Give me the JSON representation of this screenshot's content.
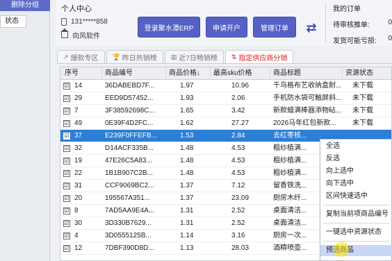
{
  "left": {
    "delete_group": "删除分组",
    "status_tab": "状态"
  },
  "user": {
    "title": "个人中心",
    "phone": "131*****858",
    "shop": "向风软件"
  },
  "buttons": {
    "login_erp": "登录聚水潭ERP",
    "apply_account": "申请开户",
    "manage_orders": "管理订单"
  },
  "orders": {
    "title": "我的订单",
    "pending_label": "待审核推单:",
    "pending_value": "0",
    "shipped_label": "发货可能亏损:",
    "shipped_value": "0"
  },
  "tabs": [
    {
      "label": "爆款专区",
      "icon": "↗"
    },
    {
      "label": "昨日热销榜",
      "icon": "🏆"
    },
    {
      "label": "近7日畅销榜",
      "icon": "▥"
    },
    {
      "label": "指定供应商分销",
      "icon": "⇅"
    }
  ],
  "table": {
    "columns": [
      "序号",
      "商品编号",
      "商品价格↓",
      "最高sku价格",
      "商品标题",
      "资源状态"
    ],
    "rows": [
      {
        "checked": "☑",
        "no": "14",
        "code": "36DABEBD7F...",
        "price": "1.97",
        "max_sku": "10.96",
        "title": "千鸟格布艺收纳盒耐...",
        "status": "未下载"
      },
      {
        "checked": "☑",
        "no": "29",
        "code": "EED9D57452...",
        "price": "1.93",
        "max_sku": "2.06",
        "title": "手机防水袋可触屏斜...",
        "status": "未下载"
      },
      {
        "checked": "☑",
        "no": "7",
        "code": "3F38592698C...",
        "price": "1.65",
        "max_sku": "3.42",
        "title": "新款蜡满棒器添物砧...",
        "status": "未下载"
      },
      {
        "checked": "☑",
        "no": "49",
        "code": "0E39F4D2FC...",
        "price": "1.62",
        "max_sku": "27.27",
        "title": "2026马年红包新款...",
        "status": "未下载"
      },
      {
        "checked": "☑",
        "no": "37",
        "code": "E239F0FFEFB...",
        "price": "1.53",
        "max_sku": "2.84",
        "title": "去红枣核...",
        "status": "",
        "selected": true
      },
      {
        "checked": "☑",
        "no": "32",
        "code": "D14ACF335B...",
        "price": "1.48",
        "max_sku": "4.53",
        "title": "粗纱植满...",
        "status": ""
      },
      {
        "checked": "☑",
        "no": "19",
        "code": "47E26C5A83...",
        "price": "1.48",
        "max_sku": "4.53",
        "title": "粗纱植满...",
        "status": ""
      },
      {
        "checked": "☑",
        "no": "22",
        "code": "1B1B907C2B...",
        "price": "1.48",
        "max_sku": "4.53",
        "title": "粗纱植满...",
        "status": ""
      },
      {
        "checked": "☑",
        "no": "31",
        "code": "CCF9069BC2...",
        "price": "1.37",
        "max_sku": "7.12",
        "title": "留香铁洗...",
        "status": ""
      },
      {
        "checked": "☑",
        "no": "20",
        "code": "195567A351...",
        "price": "1.37",
        "max_sku": "23.09",
        "title": "厨房木纤...",
        "status": ""
      },
      {
        "checked": "☑",
        "no": "8",
        "code": "7AD5AA9E4A...",
        "price": "1.31",
        "max_sku": "2.52",
        "title": "桌面清洁...",
        "status": ""
      },
      {
        "checked": "☑",
        "no": "30",
        "code": "3D330B7629...",
        "price": "1.31",
        "max_sku": "2.52",
        "title": "桌面清洁...",
        "status": ""
      },
      {
        "checked": "☑",
        "no": "4",
        "code": "3D0555125B...",
        "price": "1.14",
        "max_sku": "3.16",
        "title": "厨房一次...",
        "status": ""
      },
      {
        "checked": "☑",
        "no": "12",
        "code": "7DBF390D8D...",
        "price": "1.13",
        "max_sku": "28.03",
        "title": "酒精喷壶...",
        "status": ""
      }
    ]
  },
  "context_menu": {
    "items": [
      "全选",
      "反选",
      "向上选中",
      "向下选中",
      "区间快速选中",
      "复制当前项商品编号",
      "一键选中资源状态",
      "预选商品"
    ]
  }
}
